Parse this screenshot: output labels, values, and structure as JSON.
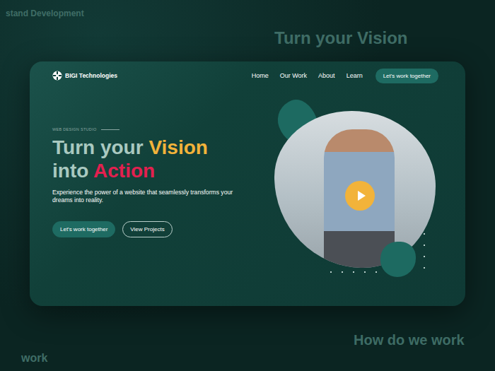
{
  "background_texts": [
    "stand Development",
    "Turn your Vision",
    "How do we work",
    "work"
  ],
  "brand": {
    "name": "BIGI Technologies"
  },
  "nav": {
    "links": [
      "Home",
      "Our Work",
      "About",
      "Learn"
    ],
    "cta": "Let's work together"
  },
  "hero": {
    "eyebrow": "WEB DESIGN STUDIO",
    "headline": [
      [
        {
          "text": "Turn your ",
          "color": "#a9c9c0"
        },
        {
          "text": "Vision",
          "color": "#f2b33a"
        }
      ],
      [
        {
          "text": "into ",
          "color": "#a9c9c0"
        },
        {
          "text": "Action",
          "color": "#e3204f"
        }
      ]
    ],
    "subtitle": "Experience the power of a website that seamlessly transforms your dreams into reality.",
    "primary_button": "Let's work together",
    "secondary_button": "View Projects"
  }
}
